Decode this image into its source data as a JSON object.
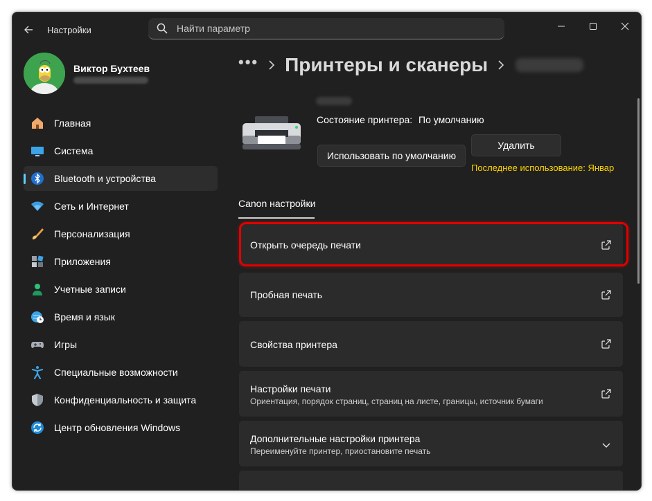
{
  "titlebar": {
    "app_title": "Настройки",
    "search_placeholder": "Найти параметр"
  },
  "profile": {
    "name": "Виктор Бухтеев"
  },
  "nav": {
    "items": [
      {
        "label": "Главная",
        "icon": "home-icon"
      },
      {
        "label": "Система",
        "icon": "monitor-icon"
      },
      {
        "label": "Bluetooth и устройства",
        "icon": "bluetooth-icon",
        "active": true
      },
      {
        "label": "Сеть и Интернет",
        "icon": "wifi-icon"
      },
      {
        "label": "Персонализация",
        "icon": "brush-icon"
      },
      {
        "label": "Приложения",
        "icon": "apps-icon"
      },
      {
        "label": "Учетные записи",
        "icon": "person-icon"
      },
      {
        "label": "Время и язык",
        "icon": "globe-clock-icon"
      },
      {
        "label": "Игры",
        "icon": "gamepad-icon"
      },
      {
        "label": "Специальные возможности",
        "icon": "accessibility-icon"
      },
      {
        "label": "Конфиденциальность и защита",
        "icon": "shield-icon"
      },
      {
        "label": "Центр обновления Windows",
        "icon": "update-icon"
      }
    ]
  },
  "breadcrumb": {
    "dots": "•••",
    "title": "Принтеры и сканеры"
  },
  "printer": {
    "status_label": "Состояние принтера:",
    "status_value": "По умолчанию",
    "set_default_button": "Использовать по умолчанию",
    "remove_button": "Удалить",
    "last_used": "Последнее использование:  Январ"
  },
  "tabs": {
    "active": "Canon настройки"
  },
  "cards": [
    {
      "title": "Открыть очередь печати",
      "subtitle": "",
      "action": "external-link-icon"
    },
    {
      "title": "Пробная печать",
      "subtitle": "",
      "action": "external-link-icon"
    },
    {
      "title": "Свойства принтера",
      "subtitle": "",
      "action": "external-link-icon"
    },
    {
      "title": "Настройки печати",
      "subtitle": "Ориентация, порядок страниц, страниц на листе, границы, источник бумаги",
      "action": "external-link-icon"
    },
    {
      "title": "Дополнительные настройки принтера",
      "subtitle": "Переименуйте принтер, приостановите печать",
      "action": "chevron-down-icon"
    }
  ],
  "colors": {
    "accent": "#60cdff",
    "highlight": "#e00000",
    "last_used": "#ffd500",
    "background": "#202020",
    "card": "#2b2b2b"
  }
}
